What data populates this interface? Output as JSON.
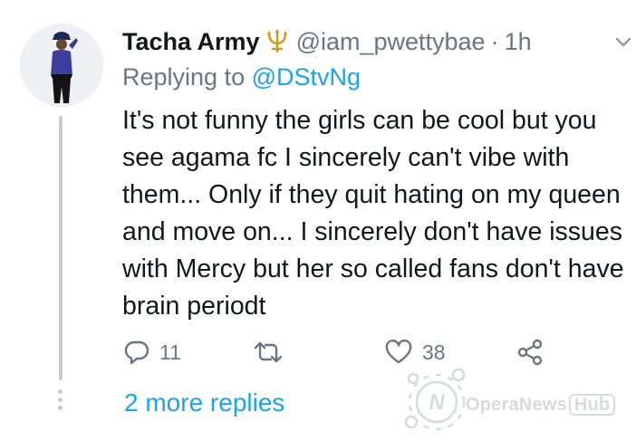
{
  "tweet": {
    "display_name": "Tacha Army",
    "name_emoji": "trident",
    "handle": "@iam_pwettybae",
    "separator": "·",
    "time": "1h",
    "replying_prefix": "Replying to",
    "replying_to": "@DStvNg",
    "text": "It's not funny the girls can be cool but you see agama fc I sincerely can't vibe with them... Only if they quit hating on my queen and move on... I sincerely don't have issues with Mercy but her so called fans don't have brain periodt"
  },
  "actions": {
    "reply_count": "11",
    "retweet_count": "",
    "like_count": "38"
  },
  "thread": {
    "more_replies": "2 more replies"
  },
  "watermark": {
    "brand": "OperaNews",
    "suffix": "Hub"
  },
  "colors": {
    "accent": "#1da1f2",
    "muted": "#657786",
    "text": "#14171a",
    "thread_line": "#c4ccd3"
  },
  "icons": [
    "chevron-down-icon",
    "reply-icon",
    "retweet-icon",
    "like-icon",
    "share-icon",
    "trident-icon"
  ]
}
